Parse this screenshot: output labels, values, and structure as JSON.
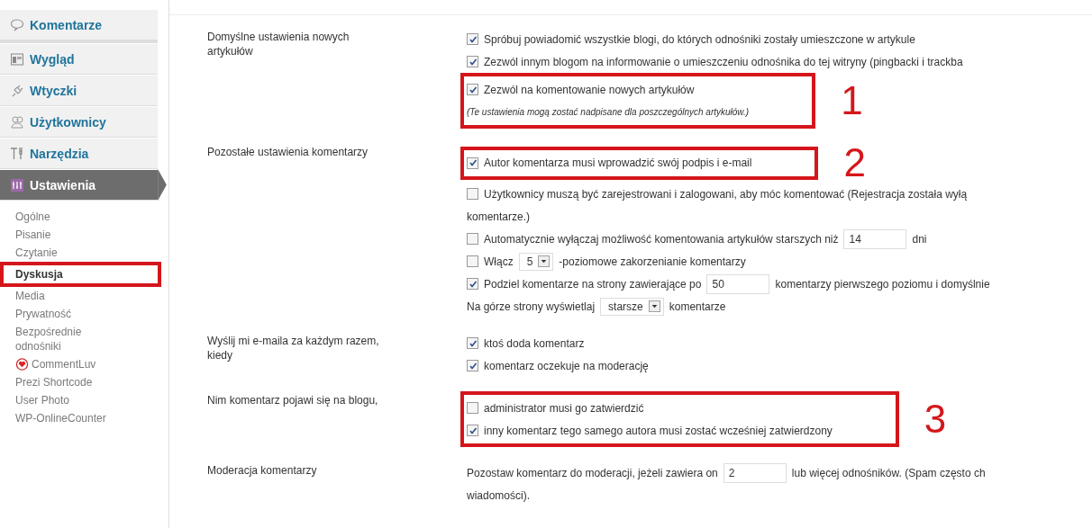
{
  "sidebar": {
    "menu": [
      {
        "label": "Komentarze",
        "kind": "comments",
        "selected": false
      },
      {
        "label": "Wygląd",
        "kind": "appearance",
        "selected": false
      },
      {
        "label": "Wtyczki",
        "kind": "plugins",
        "selected": false
      },
      {
        "label": "Użytkownicy",
        "kind": "users",
        "selected": false
      },
      {
        "label": "Narzędzia",
        "kind": "tools",
        "selected": false
      },
      {
        "label": "Ustawienia",
        "kind": "settings",
        "selected": true
      }
    ],
    "submenu": [
      {
        "label": "Ogólne",
        "selected": false
      },
      {
        "label": "Pisanie",
        "selected": false
      },
      {
        "label": "Czytanie",
        "selected": false
      },
      {
        "label": "Dyskusja",
        "selected": true,
        "marked": true
      },
      {
        "label": "Media",
        "selected": false
      },
      {
        "label": "Prywatność",
        "selected": false
      },
      {
        "label": "Bezpośrednie odnośniki",
        "selected": false
      },
      {
        "label": "CommentLuv",
        "selected": false,
        "kind": "plugin"
      },
      {
        "label": "Prezi Shortcode",
        "selected": false
      },
      {
        "label": "User Photo",
        "selected": false
      },
      {
        "label": "WP-OnlineCounter",
        "selected": false
      }
    ]
  },
  "sections": [
    {
      "label": "Domyślne ustawienia nowych artykułów",
      "groups": [
        {
          "rows": [
            {
              "kind": "checkbox",
              "checked": true,
              "parts": [
                {
                  "kind": "text",
                  "text": "Spróbuj powiadomić wszystkie blogi, do których odnośniki zostały umieszczone w artykule"
                }
              ]
            },
            {
              "kind": "checkbox",
              "checked": true,
              "parts": [
                {
                  "kind": "text",
                  "text": "Zezwól innym blogom na informowanie o umieszczeniu odnośnika do tej witryny (pingbacki i trackba"
                }
              ]
            }
          ]
        },
        {
          "marker": "1",
          "rows": [
            {
              "kind": "checkbox",
              "checked": true,
              "parts": [
                {
                  "kind": "text",
                  "text": "Zezwól na komentowanie nowych artykułów"
                }
              ]
            },
            {
              "kind": "note",
              "parts": [
                {
                  "kind": "text",
                  "text": "(Te ustawienia mogą zostać nadpisane dla poszczególnych artykułów.)"
                }
              ]
            }
          ]
        }
      ]
    },
    {
      "label": "Pozostałe ustawienia komentarzy",
      "groups": [
        {
          "marker": "2",
          "rows": [
            {
              "kind": "checkbox",
              "checked": true,
              "parts": [
                {
                  "kind": "text",
                  "text": "Autor komentarza musi wprowadzić swój podpis i e-mail"
                }
              ]
            }
          ]
        },
        {
          "rows": [
            {
              "kind": "checkbox",
              "checked": false,
              "parts": [
                {
                  "kind": "text",
                  "text": "Użytkownicy muszą być zarejestrowani i zalogowani, aby móc komentować (Rejestracja została wyłą"
                }
              ]
            },
            {
              "kind": "plain",
              "parts": [
                {
                  "kind": "text",
                  "text": "komentarze.)"
                }
              ]
            },
            {
              "kind": "checkbox",
              "checked": false,
              "parts": [
                {
                  "kind": "text",
                  "text": "Automatycznie wyłączaj możliwość komentowania artykułów starszych niż"
                },
                {
                  "kind": "input",
                  "value": "14"
                },
                {
                  "kind": "text",
                  "text": "dni"
                }
              ]
            },
            {
              "kind": "checkbox",
              "checked": false,
              "parts": [
                {
                  "kind": "text",
                  "text": "Włącz"
                },
                {
                  "kind": "select",
                  "value": "5"
                },
                {
                  "kind": "text",
                  "text": "-poziomowe zakorzenianie komentarzy"
                }
              ]
            },
            {
              "kind": "checkbox",
              "checked": true,
              "parts": [
                {
                  "kind": "text",
                  "text": "Podziel komentarze na strony zawierające po"
                },
                {
                  "kind": "input",
                  "value": "50"
                },
                {
                  "kind": "text",
                  "text": "komentarzy pierwszego poziomu i domyślnie"
                }
              ]
            },
            {
              "kind": "plain",
              "parts": [
                {
                  "kind": "text",
                  "text": "Na górze strony wyświetlaj"
                },
                {
                  "kind": "select",
                  "value": "starsze"
                },
                {
                  "kind": "text",
                  "text": "komentarze"
                }
              ]
            }
          ]
        }
      ]
    },
    {
      "label": "Wyślij mi e-maila za każdym razem, kiedy",
      "groups": [
        {
          "rows": [
            {
              "kind": "checkbox",
              "checked": true,
              "parts": [
                {
                  "kind": "text",
                  "text": "ktoś doda komentarz"
                }
              ]
            },
            {
              "kind": "checkbox",
              "checked": true,
              "parts": [
                {
                  "kind": "text",
                  "text": "komentarz oczekuje na moderację"
                }
              ]
            }
          ]
        }
      ]
    },
    {
      "label": "Nim komentarz pojawi się na blogu,",
      "groups": [
        {
          "marker": "3",
          "rows": [
            {
              "kind": "checkbox",
              "checked": false,
              "parts": [
                {
                  "kind": "text",
                  "text": "administrator musi go zatwierdzić"
                }
              ]
            },
            {
              "kind": "checkbox",
              "checked": true,
              "parts": [
                {
                  "kind": "text",
                  "text": "inny komentarz tego samego autora musi zostać wcześniej zatwierdzony"
                }
              ]
            }
          ]
        }
      ]
    },
    {
      "label": "Moderacja komentarzy",
      "groups": [
        {
          "rows": [
            {
              "kind": "plain",
              "parts": [
                {
                  "kind": "text",
                  "text": "Pozostaw komentarz do moderacji, jeżeli zawiera on"
                },
                {
                  "kind": "input",
                  "value": "2"
                },
                {
                  "kind": "text",
                  "text": "lub więcej odnośników. (Spam często ch"
                }
              ]
            },
            {
              "kind": "plain",
              "parts": [
                {
                  "kind": "text",
                  "text": "wiadomości)."
                }
              ]
            }
          ]
        }
      ]
    }
  ]
}
